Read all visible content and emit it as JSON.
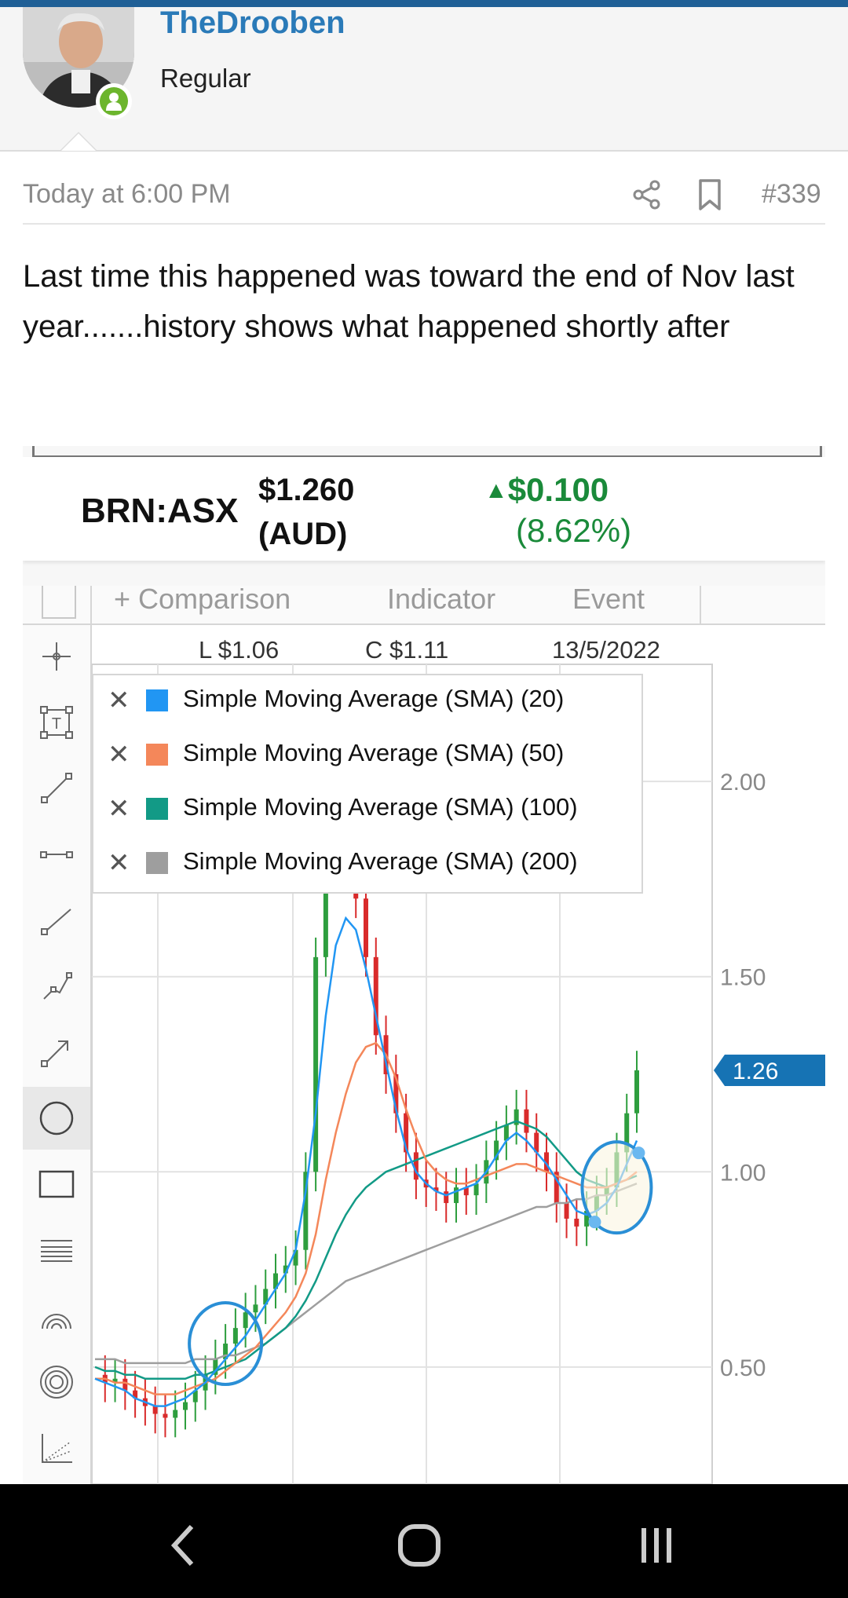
{
  "user": {
    "name": "TheDrooben",
    "title": "Regular"
  },
  "post": {
    "time": "Today at 6:00 PM",
    "number": "#339",
    "body": "Last time this happened was toward the end of Nov last year.......history shows what happened shortly after"
  },
  "quote": {
    "symbol": "BRN:ASX",
    "price": "$1.260",
    "currency": "(AUD)",
    "change": "$0.100",
    "change_pct": "(8.62%)",
    "change_arrow": "▲",
    "up_color": "#1a8a3a"
  },
  "chart_tabs": [
    "+ Comparison",
    "Indicator",
    "Event"
  ],
  "ohlc": {
    "low": "L $1.06",
    "close": "C $1.11",
    "date": "13/5/2022"
  },
  "legend": [
    {
      "label": "Simple Moving Average (SMA) (20)",
      "color": "#2196f3"
    },
    {
      "label": "Simple Moving Average (SMA) (50)",
      "color": "#f4875a"
    },
    {
      "label": "Simple Moving Average (SMA) (100)",
      "color": "#129a86"
    },
    {
      "label": "Simple Moving Average (SMA) (200)",
      "color": "#9e9e9e"
    }
  ],
  "chart_data": {
    "type": "line",
    "y_ticks": [
      "2.00",
      "1.50",
      "1.00",
      "0.50"
    ],
    "ylim": [
      0.2,
      2.3
    ],
    "last_price_label": "1.26",
    "price_path": [
      0.48,
      0.46,
      0.47,
      0.44,
      0.42,
      0.4,
      0.38,
      0.37,
      0.39,
      0.41,
      0.44,
      0.48,
      0.52,
      0.56,
      0.6,
      0.64,
      0.66,
      0.7,
      0.74,
      0.76,
      0.8,
      1.0,
      1.55,
      2.0,
      1.8,
      1.95,
      1.7,
      1.55,
      1.35,
      1.25,
      1.15,
      1.05,
      0.98,
      0.96,
      0.95,
      0.92,
      0.96,
      0.94,
      0.97,
      1.03,
      1.08,
      1.12,
      1.16,
      1.1,
      1.05,
      1.0,
      0.92,
      0.88,
      0.86,
      0.9,
      0.94,
      0.96,
      1.05,
      1.15,
      1.26
    ],
    "sma20": [
      0.47,
      0.46,
      0.45,
      0.44,
      0.42,
      0.41,
      0.4,
      0.4,
      0.41,
      0.42,
      0.44,
      0.46,
      0.49,
      0.52,
      0.55,
      0.58,
      0.62,
      0.66,
      0.7,
      0.74,
      0.8,
      0.95,
      1.15,
      1.4,
      1.58,
      1.65,
      1.62,
      1.52,
      1.4,
      1.28,
      1.16,
      1.06,
      1.0,
      0.97,
      0.95,
      0.94,
      0.95,
      0.96,
      0.97,
      1.0,
      1.04,
      1.08,
      1.1,
      1.08,
      1.05,
      1.02,
      0.98,
      0.94,
      0.9,
      0.89,
      0.9,
      0.92,
      0.96,
      1.02,
      1.08
    ],
    "sma50": [
      0.47,
      0.47,
      0.46,
      0.46,
      0.45,
      0.44,
      0.43,
      0.43,
      0.43,
      0.44,
      0.45,
      0.46,
      0.47,
      0.49,
      0.51,
      0.53,
      0.55,
      0.58,
      0.61,
      0.64,
      0.68,
      0.74,
      0.84,
      0.98,
      1.1,
      1.2,
      1.28,
      1.32,
      1.33,
      1.3,
      1.24,
      1.16,
      1.09,
      1.03,
      1.0,
      0.98,
      0.97,
      0.97,
      0.98,
      0.99,
      1.0,
      1.01,
      1.02,
      1.02,
      1.01,
      1.0,
      0.99,
      0.98,
      0.97,
      0.96,
      0.96,
      0.96,
      0.97,
      0.98,
      1.0
    ],
    "sma100": [
      0.5,
      0.49,
      0.49,
      0.48,
      0.48,
      0.47,
      0.47,
      0.47,
      0.47,
      0.47,
      0.48,
      0.48,
      0.49,
      0.5,
      0.51,
      0.52,
      0.54,
      0.56,
      0.58,
      0.6,
      0.63,
      0.67,
      0.72,
      0.78,
      0.84,
      0.89,
      0.93,
      0.96,
      0.98,
      1.0,
      1.01,
      1.02,
      1.03,
      1.04,
      1.05,
      1.06,
      1.07,
      1.08,
      1.09,
      1.1,
      1.11,
      1.12,
      1.13,
      1.12,
      1.11,
      1.09,
      1.06,
      1.03,
      1.0,
      0.98,
      0.97,
      0.96,
      0.97,
      0.98,
      0.99
    ],
    "sma200": [
      0.52,
      0.52,
      0.52,
      0.51,
      0.51,
      0.51,
      0.51,
      0.51,
      0.51,
      0.51,
      0.52,
      0.52,
      0.52,
      0.53,
      0.53,
      0.54,
      0.55,
      0.56,
      0.58,
      0.6,
      0.62,
      0.64,
      0.66,
      0.68,
      0.7,
      0.72,
      0.73,
      0.74,
      0.75,
      0.76,
      0.77,
      0.78,
      0.79,
      0.8,
      0.81,
      0.82,
      0.83,
      0.84,
      0.85,
      0.86,
      0.87,
      0.88,
      0.89,
      0.9,
      0.91,
      0.91,
      0.92,
      0.92,
      0.93,
      0.93,
      0.94,
      0.94,
      0.95,
      0.96,
      0.97
    ],
    "annotation_circle_color": "#2a8fd6"
  },
  "nav": {
    "back": "back-icon",
    "home": "home-icon",
    "recents": "recents-icon"
  }
}
